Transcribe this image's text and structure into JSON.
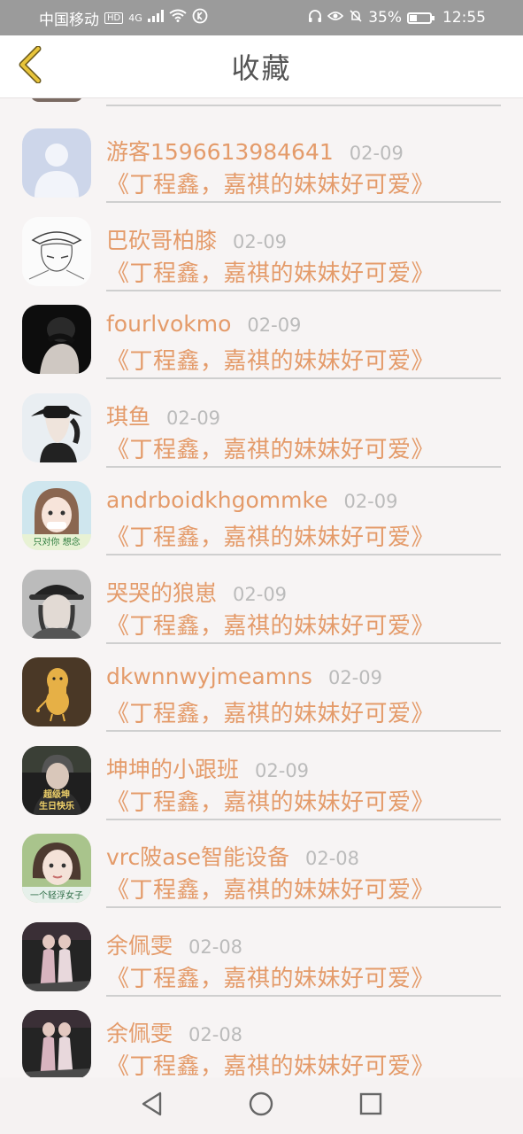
{
  "status_bar": {
    "carrier": "中国移动",
    "network": "4G",
    "battery": "35%",
    "battery_level": 0.35,
    "time": "12:55"
  },
  "header": {
    "title": "收藏",
    "back_icon": "chevron-left-icon",
    "accent": "#e8c43a"
  },
  "colors": {
    "name": "#e49b6a",
    "date": "#bbbbbb",
    "title": "#e49b6a"
  },
  "favorites": [
    {
      "user": "游客1596613984641",
      "date": "02-09",
      "title": "《丁程鑫，嘉祺的妹妹好可爱》",
      "avatar": "default-user-icon"
    },
    {
      "user": "巴砍哥柏膝",
      "date": "02-09",
      "title": "《丁程鑫，嘉祺的妹妹好可爱》",
      "avatar": "sketch-avatar"
    },
    {
      "user": "fourlvokmo",
      "date": "02-09",
      "title": "《丁程鑫，嘉祺的妹妹好可爱》",
      "avatar": "dark-photo-avatar"
    },
    {
      "user": "琪鱼",
      "date": "02-09",
      "title": "《丁程鑫，嘉祺的妹妹好可爱》",
      "avatar": "hat-photo-avatar"
    },
    {
      "user": "andrboidkhgommke",
      "date": "02-09",
      "title": "《丁程鑫，嘉祺的妹妹好可爱》",
      "avatar": "girl-photo-avatar"
    },
    {
      "user": "哭哭的狼崽",
      "date": "02-09",
      "title": "《丁程鑫，嘉祺的妹妹好可爱》",
      "avatar": "cap-photo-avatar"
    },
    {
      "user": "dkwnnwyjmeamns",
      "date": "02-09",
      "title": "《丁程鑫，嘉祺的妹妹好可爱》",
      "avatar": "peanut-avatar"
    },
    {
      "user": "坤坤的小跟班",
      "date": "02-09",
      "title": "《丁程鑫，嘉祺的妹妹好可爱》",
      "avatar": "birthday-photo-avatar"
    },
    {
      "user": "vrc陂ase智能设备",
      "date": "02-08",
      "title": "《丁程鑫，嘉祺的妹妹好可爱》",
      "avatar": "portrait-photo-avatar"
    },
    {
      "user": "余佩雯",
      "date": "02-08",
      "title": "《丁程鑫，嘉祺的妹妹好可爱》",
      "avatar": "stage-photo-avatar"
    },
    {
      "user": "余佩雯",
      "date": "02-08",
      "title": "《丁程鑫，嘉祺的妹妹好可爱》",
      "avatar": "stage-photo-avatar"
    }
  ],
  "avatar_texts": {
    "girl_caption": "只对你 想念",
    "birthday_caption": "超级坤 生日快乐",
    "portrait_caption": "一个轻浮女子"
  },
  "nav_bar": {
    "back": "triangle-back-icon",
    "home": "circle-home-icon",
    "recents": "square-recents-icon"
  }
}
